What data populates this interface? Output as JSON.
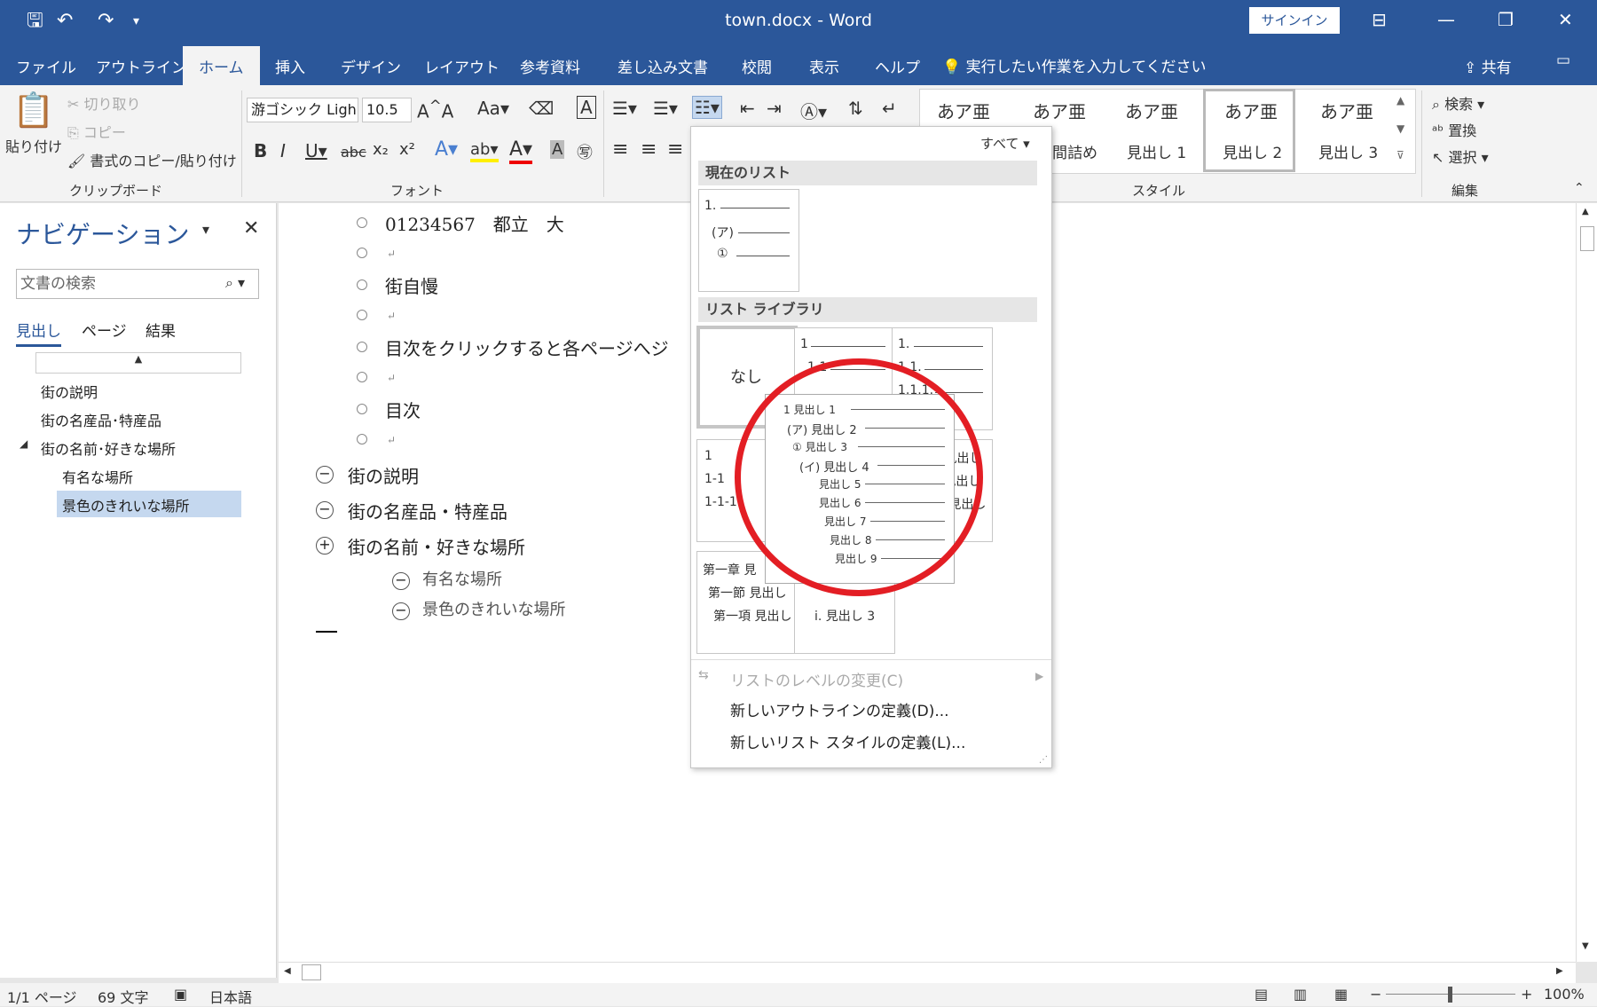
{
  "title": {
    "doc": "town.docx  -  Word",
    "signin": "サインイン"
  },
  "tabs": [
    "ファイル",
    "アウトライン",
    "ホーム",
    "挿入",
    "デザイン",
    "レイアウト",
    "参考資料",
    "差し込み文書",
    "校閲",
    "表示",
    "ヘルプ"
  ],
  "tellme": "実行したい作業を入力してください",
  "share": "共有",
  "clipboard": {
    "paste": "貼り付け",
    "cut": "切り取り",
    "copy": "コピー",
    "format": "書式のコピー/貼り付け",
    "label": "クリップボード"
  },
  "font": {
    "name": "游ゴシック Ligh",
    "size": "10.5",
    "label": "フォント"
  },
  "styles": {
    "items": [
      {
        "preview": "あア亜",
        "name": "見出し 2"
      },
      {
        "preview": "あア亜",
        "name": "見出し 3"
      },
      {
        "preview": "あア亜",
        "name": "見出し 1"
      },
      {
        "preview": "あア亜",
        "name": "間詰め"
      },
      {
        "preview": "あア亜",
        "name": ""
      }
    ],
    "label": "スタイル"
  },
  "edit": {
    "find": "検索",
    "replace": "置換",
    "select": "選択",
    "label": "編集"
  },
  "nav": {
    "title": "ナビゲーション",
    "search_placeholder": "文書の検索",
    "tabs": [
      "見出し",
      "ページ",
      "結果"
    ],
    "headings": [
      "街の説明",
      "街の名産品･特産品",
      "街の名前･好きな場所",
      "有名な場所",
      "景色のきれいな場所"
    ]
  },
  "doc": {
    "lines": [
      "01234567　都立　大",
      "",
      "街自慢",
      "",
      "目次をクリックすると各ページへジ",
      "",
      "目次",
      ""
    ],
    "headings": [
      "街の説明",
      "街の名産品・特産品",
      "街の名前・好きな場所",
      "有名な場所",
      "景色のきれいな場所"
    ]
  },
  "gallery": {
    "filter": "すべて",
    "current": "現在のリスト",
    "library": "リスト ライブラリ",
    "none": "なし",
    "menu": [
      "リストのレベルの変更(C)",
      "新しいアウトラインの定義(D)...",
      "新しいリスト スタイルの定義(L)..."
    ]
  },
  "tooltip": [
    "1 見出し 1",
    "(ア) 見出し 2",
    "① 見出し 3",
    "(イ) 見出し 4",
    "見出し 5",
    "見出し 6",
    "見出し 7",
    "見出し 8",
    "見出し 9"
  ],
  "status": {
    "page": "1/1 ページ",
    "words": "69 文字",
    "lang": "日本語",
    "zoom": "100%"
  }
}
